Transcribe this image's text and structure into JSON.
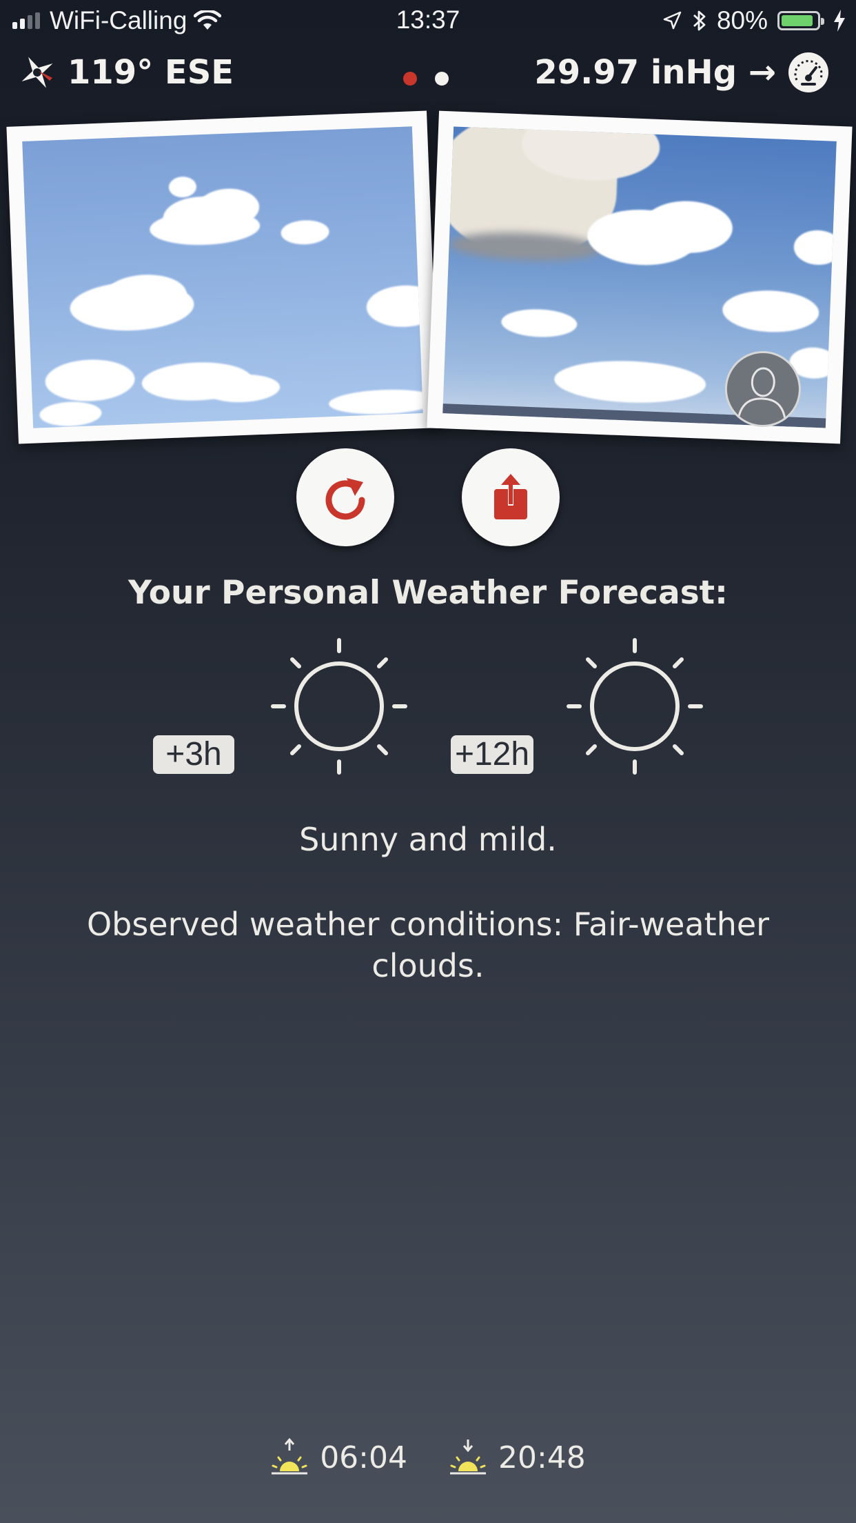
{
  "status_bar": {
    "carrier": "WiFi-Calling",
    "time": "13:37",
    "battery_percent": "80%",
    "battery_level": 0.8
  },
  "header": {
    "wind_direction": "119° ESE",
    "pressure": "29.97 inHg →",
    "page_count": 2,
    "active_page": 0
  },
  "actions": {
    "refresh_icon": "refresh-icon",
    "share_icon": "share-icon"
  },
  "forecast": {
    "title": "Your Personal Weather Forecast:",
    "items": [
      {
        "offset": "+3h",
        "icon": "sun-icon"
      },
      {
        "offset": "+12h",
        "icon": "sun-icon"
      }
    ],
    "summary": "Sunny and mild.",
    "observed": "Observed weather conditions: Fair-weather clouds."
  },
  "sun_times": {
    "sunrise": "06:04",
    "sunset": "20:48"
  },
  "colors": {
    "accent_red": "#c9362b",
    "sun_yellow": "#f1e35a",
    "text_light": "#ecebe6"
  }
}
